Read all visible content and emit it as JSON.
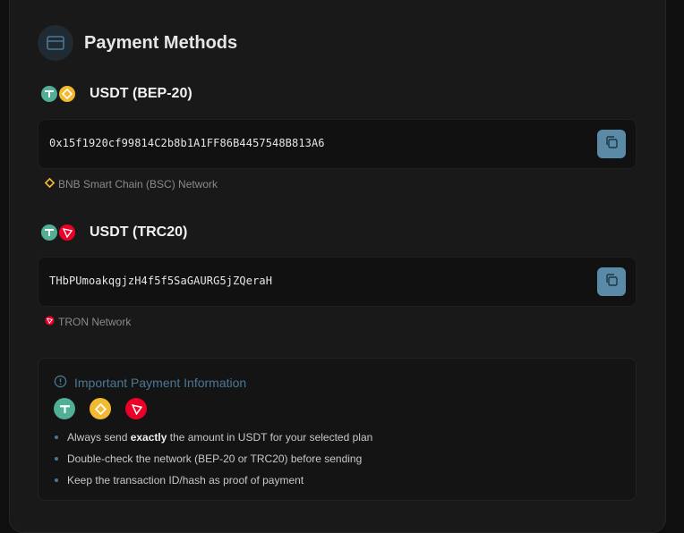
{
  "header": {
    "title": "Payment Methods",
    "icon": "credit-card-icon"
  },
  "methods": [
    {
      "label": "USDT (BEP-20)",
      "address": "0x15f1920cf99814C2b8b1A1FF86B4457548B813A6",
      "network": "BNB Smart Chain (BSC) Network",
      "coins": [
        "usdt-icon",
        "bnb-icon"
      ],
      "copy_icon": "copy-icon"
    },
    {
      "label": "USDT (TRC20)",
      "address": "THbPUmoakqgjzH4f5f5SaGAURG5jZQeraH",
      "network": "TRON Network",
      "coins": [
        "usdt-icon",
        "tron-icon"
      ],
      "copy_icon": "copy-icon"
    }
  ],
  "info": {
    "title": "Important Payment Information",
    "icons": [
      "usdt-icon",
      "bnb-icon",
      "tron-icon"
    ],
    "items": [
      {
        "pre": "Always send ",
        "bold": "exactly",
        "post": " the amount in USDT for your selected plan"
      },
      {
        "pre": "Double-check the network (BEP-20 or TRC20) before sending",
        "bold": "",
        "post": ""
      },
      {
        "pre": "Keep the transaction ID/hash as proof of payment",
        "bold": "",
        "post": ""
      }
    ]
  },
  "colors": {
    "usdt": "#50af95",
    "bnb": "#f3ba2f",
    "tron": "#eb0029",
    "accent": "#4b7893",
    "copy_button": "#5b8aa6"
  }
}
